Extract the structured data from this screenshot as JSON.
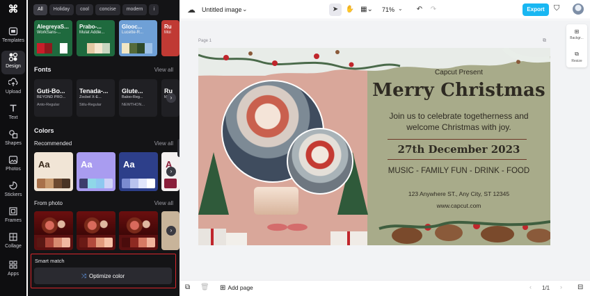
{
  "rail": {
    "items": [
      {
        "label": "Templates",
        "icon": "templates-icon"
      },
      {
        "label": "Design",
        "icon": "design-icon"
      },
      {
        "label": "Upload",
        "icon": "upload-icon"
      },
      {
        "label": "Text",
        "icon": "text-icon"
      },
      {
        "label": "Shapes",
        "icon": "shapes-icon"
      },
      {
        "label": "Photos",
        "icon": "photos-icon"
      },
      {
        "label": "Stickers",
        "icon": "stickers-icon"
      },
      {
        "label": "Frames",
        "icon": "frames-icon"
      },
      {
        "label": "Collage",
        "icon": "collage-icon"
      },
      {
        "label": "Apps",
        "icon": "apps-icon"
      }
    ]
  },
  "panel": {
    "chips": [
      "All",
      "Holiday",
      "cool",
      "concise",
      "modern",
      "i"
    ],
    "font_combos": [
      {
        "name": "AlegreyaS...",
        "sub": "WorkSans-...",
        "bg": "#1f6a3e",
        "swatches": [
          "#c81e2a",
          "#8f1a1e",
          "#1f6a3e",
          "#ffffff"
        ]
      },
      {
        "name": "Prabo-...",
        "sub": "Mulat Addie...",
        "bg": "#1f6a3e",
        "swatches": [
          "#1f6a3e",
          "#e4c9a4",
          "#f4e6cf",
          "#c8d6c0"
        ]
      },
      {
        "name": "Glooc...",
        "sub": "Lucette-R...",
        "bg": "#6fa0d6",
        "swatches": [
          "#f2e6c4",
          "#556b3a",
          "#2f4a2a",
          "#9fc2e8"
        ]
      },
      {
        "name": "Ru",
        "sub": "Moi",
        "bg": "#c03a34",
        "swatches": [
          "#c03a34"
        ]
      }
    ],
    "fonts": {
      "title": "Fonts",
      "view_all": "View all",
      "items": [
        {
          "line1": "Guti-Bo...",
          "line2": "BEYOND PRO...",
          "line3": "Anto-Regular"
        },
        {
          "line1": "Tenada-...",
          "line2": "Zocbel X-E...",
          "line3": "Stilu-Regular"
        },
        {
          "line1": "Glute...",
          "line2": "Baloo-Reg...",
          "line3": "NEWTHON..."
        },
        {
          "line1": "Ru",
          "line2": "Mo",
          "line3": ""
        }
      ]
    },
    "colors": {
      "title": "Colors",
      "recommended": "Recommended",
      "view_all": "View all",
      "palettes": [
        {
          "bg": "#f1e5d6",
          "fg": "#3a2a1c",
          "bar": [
            "#a8714a",
            "#c89a6e",
            "#6d4a30",
            "#4a3424"
          ]
        },
        {
          "bg": "#a99cf0",
          "fg": "#ffffff",
          "bar": [
            "#3d3d6c",
            "#8fd7e8",
            "#8ec8f0",
            "#cfd2f7"
          ]
        },
        {
          "bg": "#2d3f8a",
          "fg": "#ffffff",
          "bar": [
            "#7b8bd0",
            "#b9c3ee",
            "#e1e6fb",
            "#ffffff"
          ]
        },
        {
          "bg": "#f4f0f0",
          "fg": "#8a1e3a",
          "bar": [
            "#8a1e3a"
          ]
        }
      ],
      "from_photo": "From photo",
      "photo_view_all": "View all",
      "photo_palettes": [
        {
          "bar": [
            "#5a1814",
            "#a84438",
            "#d88a70",
            "#f0b8a0"
          ]
        },
        {
          "bar": [
            "#6a1a16",
            "#b24a3c",
            "#e29a7c",
            "#f6c2a8"
          ]
        },
        {
          "bar": [
            "#4a0c0c",
            "#8e2a22",
            "#d67a64",
            "#f0b49c"
          ]
        },
        {
          "bar": [
            "#c8b49a"
          ]
        }
      ]
    },
    "smart_match": {
      "label": "Smart match",
      "button": "Optimize color"
    }
  },
  "topbar": {
    "title": "Untitled image",
    "zoom": "71%",
    "export_label": "Export"
  },
  "workspace": {
    "page_label": "Page 1",
    "right_tools": [
      {
        "label": "Backgr..."
      },
      {
        "label": "Resize"
      }
    ]
  },
  "poster": {
    "subtitle": "Capcut Present",
    "title": "Merry Christmas",
    "desc_line1": "Join us to celebrate togetherness and",
    "desc_line2": "welcome Christmas with joy.",
    "date": "27th December 2023",
    "activities": "MUSIC -  FAMILY FUN - DRINK - FOOD",
    "address": "123 Anywhere ST., Any City, ST 12345",
    "website": "www.capcut.com"
  },
  "bottombar": {
    "add_page": "Add page",
    "page_count": "1/1"
  },
  "colors": {
    "accent": "#19b7f2",
    "panel_bg": "#141416",
    "rail_bg": "#0e0e10",
    "poster_bg": "#a8ab8a",
    "highlight": "#d9262c"
  }
}
